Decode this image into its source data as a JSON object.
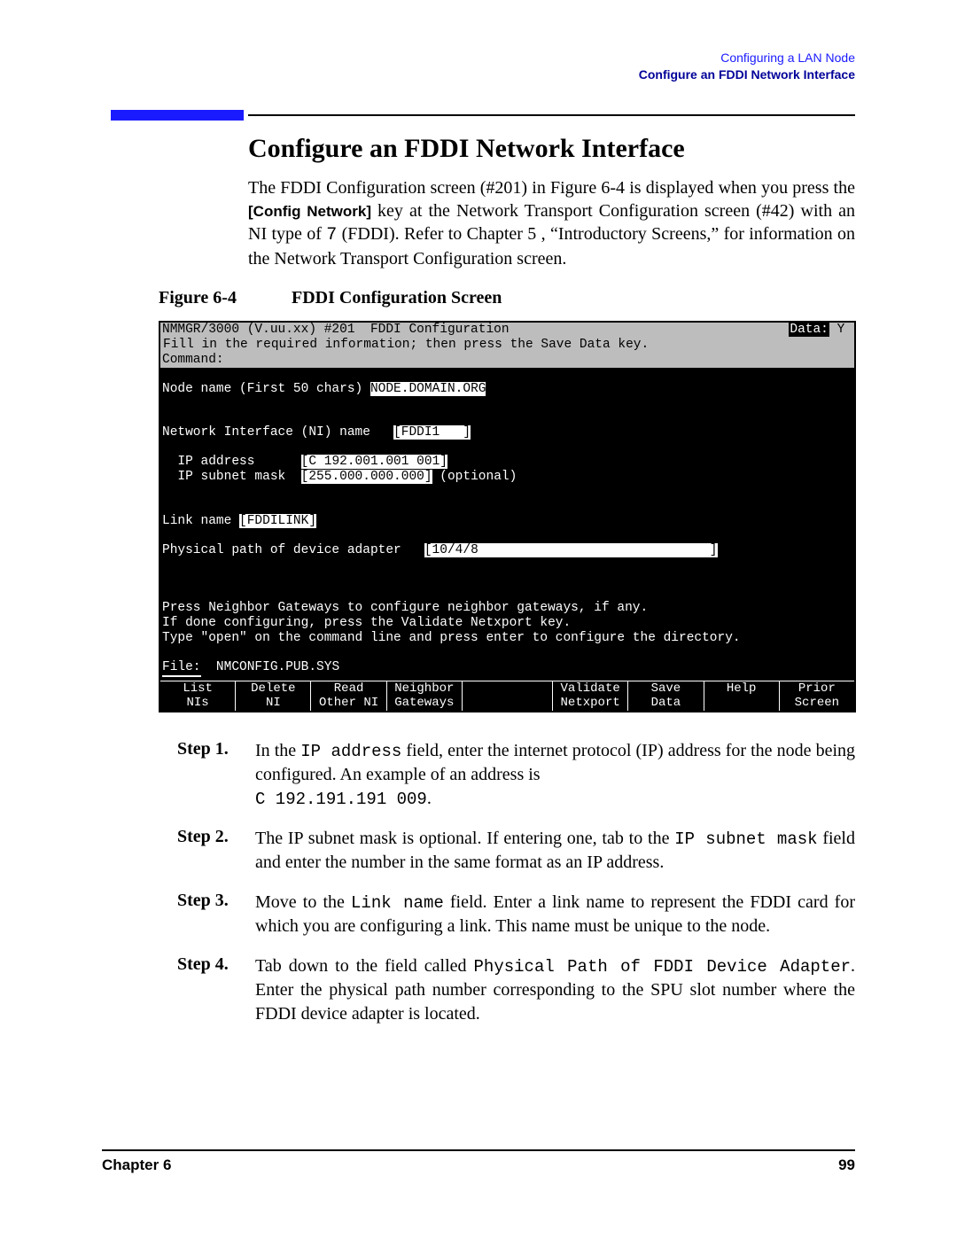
{
  "header": {
    "chapter": "Configuring a LAN Node",
    "section": "Configure an FDDI Network Interface"
  },
  "title": "Configure an FDDI Network Interface",
  "intro": {
    "t1": "The FDDI Configuration screen (#201) in Figure 6-4 is displayed when you press the ",
    "key": "[Config Network]",
    "t2": " key at the Network Transport Configuration screen (#42) with an NI type of ",
    "ni": "7",
    "t3": " (FDDI). Refer to Chapter 5 , “Introductory Screens,” for information on the Network Transport Configuration screen."
  },
  "figure": {
    "num": "Figure 6-4",
    "title": "FDDI Configuration Screen"
  },
  "term": {
    "title_left": "NMMGR/3000 (V.uu.xx) #201  FDDI Configuration",
    "data_label": "Data:",
    "data_val": " Y ",
    "instruct": "Fill in the required information; then press the Save Data key.",
    "cmd_label": "Command:",
    "node_label": "Node name (First 50 chars) ",
    "node_val": "NODE.DOMAIN.ORG",
    "ni_label": "Network Interface (NI) name   ",
    "ni_val": "[FDDI1   ]",
    "ip_label": "  IP address      ",
    "ip_val": "[C 192.001.001 001]",
    "mask_label": "  IP subnet mask  ",
    "mask_val": "[255.000.000.000]",
    "mask_opt": " (optional)",
    "link_label": "Link name ",
    "link_val": "[FDDILINK]",
    "phys_label": "Physical path of device adapter   ",
    "phys_val": "[10/4/8                              ]",
    "hint1": "Press Neighbor Gateways to configure neighbor gateways, if any.",
    "hint2": "If done configuring, press the Validate Netxport key.",
    "hint3": "Type \"open\" on the command line and press enter to configure the directory.",
    "file_label": "File:",
    "file_val": "  NMCONFIG.PUB.SYS",
    "fkeys": [
      {
        "l1": "List",
        "l2": "NIs"
      },
      {
        "l1": "Delete",
        "l2": "NI"
      },
      {
        "l1": "Read",
        "l2": "Other NI"
      },
      {
        "l1": "Neighbor",
        "l2": "Gateways"
      },
      {
        "l1": "",
        "l2": ""
      },
      {
        "l1": "Validate",
        "l2": "Netxport"
      },
      {
        "l1": "Save",
        "l2": "Data"
      },
      {
        "l1": "Help",
        "l2": ""
      },
      {
        "l1": "Prior",
        "l2": "Screen"
      }
    ]
  },
  "steps": [
    {
      "label": "Step 1.",
      "parts": [
        {
          "t": "In the "
        },
        {
          "m": "IP address"
        },
        {
          "t": " field, enter the internet protocol (IP) address for the node being configured. An example of an address is "
        },
        {
          "br": true
        },
        {
          "m": "C 192.191.191 009"
        },
        {
          "t": "."
        }
      ]
    },
    {
      "label": "Step 2.",
      "parts": [
        {
          "t": "The IP subnet mask is optional. If entering one, tab to the "
        },
        {
          "m": "IP subnet mask"
        },
        {
          "t": " field and enter the number in the same format as an IP address."
        }
      ]
    },
    {
      "label": "Step 3.",
      "parts": [
        {
          "t": "Move to the "
        },
        {
          "m": "Link name"
        },
        {
          "t": " field. Enter a link name to represent the FDDI card for which you are configuring a link. This name must be unique to the node."
        }
      ]
    },
    {
      "label": "Step 4.",
      "parts": [
        {
          "t": "Tab down to the field called "
        },
        {
          "m": "Physical Path of FDDI Device Adapter"
        },
        {
          "t": ". Enter the physical path number corresponding to the SPU slot number where the FDDI device adapter is located."
        }
      ]
    }
  ],
  "footer": {
    "left": "Chapter 6",
    "right": "99"
  }
}
